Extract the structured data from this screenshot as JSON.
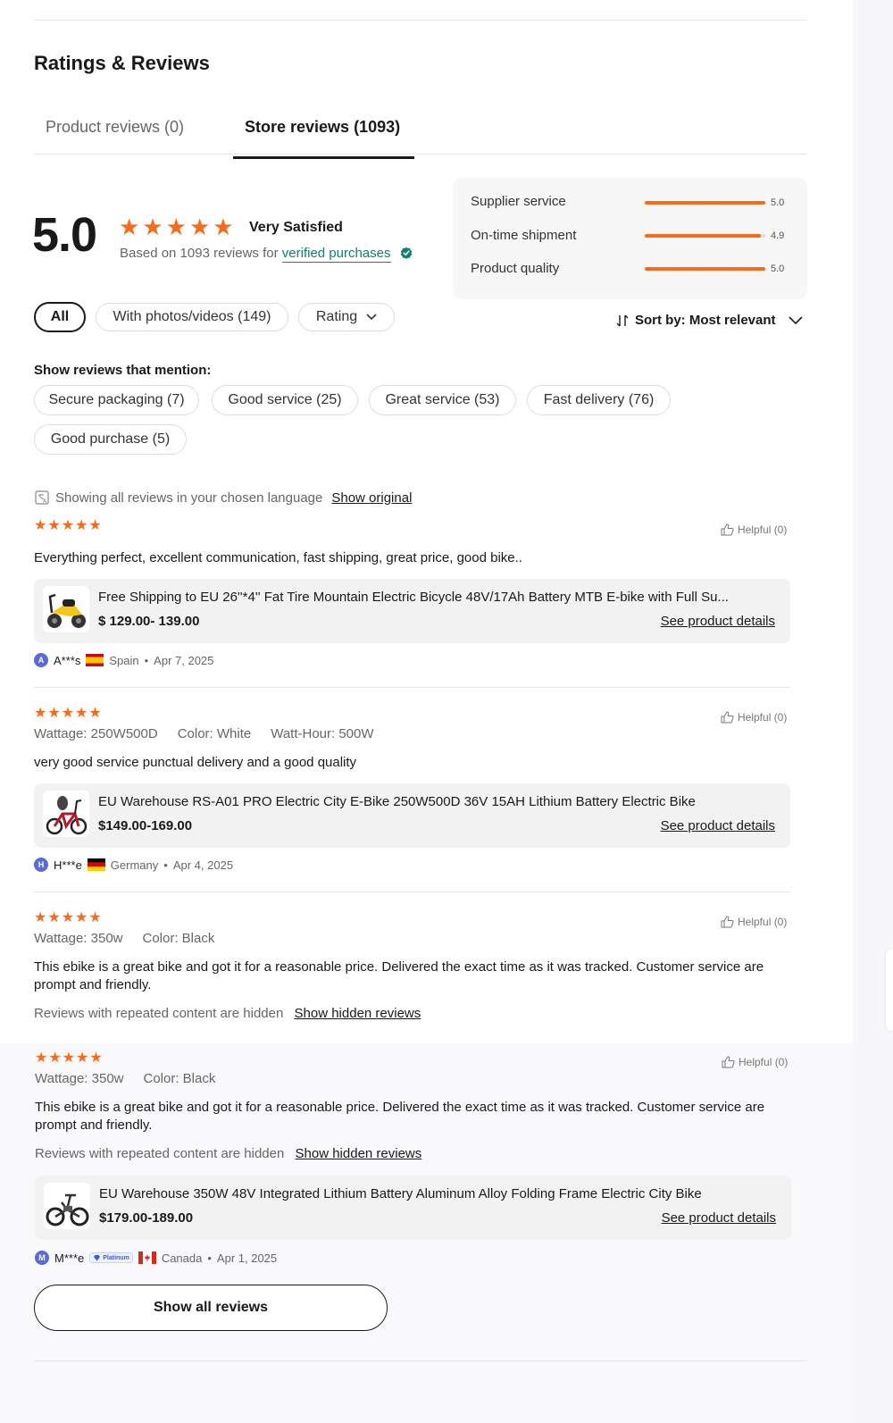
{
  "section_title": "Ratings & Reviews",
  "tabs": [
    {
      "label": "Product reviews (0)",
      "active": false
    },
    {
      "label": "Store reviews (1093)",
      "active": true
    }
  ],
  "summary": {
    "score": "5.0",
    "star_count": 5,
    "satisfaction": "Very Satisfied",
    "based_prefix": "Based on 1093 reviews for",
    "verified_link": "verified purchases"
  },
  "metrics": [
    {
      "label": "Supplier service",
      "value": "5.0",
      "fraction": 1.0
    },
    {
      "label": "On-time shipment",
      "value": "4.9",
      "fraction": 0.96
    },
    {
      "label": "Product quality",
      "value": "5.0",
      "fraction": 1.0
    }
  ],
  "filters": {
    "all": "All",
    "photos": "With photos/videos (149)",
    "rating": "Rating"
  },
  "sort": {
    "label": "Sort by: Most relevant"
  },
  "mentions": {
    "label": "Show reviews that mention:",
    "tags": [
      "Secure packaging (7)",
      "Good service (25)",
      "Great service (53)",
      "Fast delivery (76)",
      "Good purchase (5)"
    ]
  },
  "language": {
    "text": "Showing all reviews in your chosen language",
    "link": "Show original"
  },
  "reviews": [
    {
      "rating": 5,
      "helpful": "Helpful (0)",
      "text": "Everything perfect, excellent communication, fast shipping, great price, good bike..",
      "product": {
        "title": "Free Shipping to EU 26''*4'' Fat Tire Mountain Electric Bicycle 48V/17Ah Battery MTB E-bike with Full Su...",
        "price": "$  129.00- 139.00",
        "link": "See product details"
      },
      "user": {
        "initial": "A",
        "name": "A***s",
        "country": "Spain",
        "date": "Apr 7, 2025"
      }
    },
    {
      "rating": 5,
      "helpful": "Helpful (0)",
      "attrs": [
        "Wattage:  250W500D",
        "Color:  White",
        "Watt-Hour:  500W"
      ],
      "text": "very good service punctual delivery and a good quality",
      "product": {
        "title": "EU Warehouse RS-A01 PRO Electric City E-Bike 250W500D 36V 15AH Lithium Battery Electric Bike",
        "price": "$149.00-169.00",
        "link": "See product details"
      },
      "user": {
        "initial": "H",
        "name": "H***e",
        "country": "Germany",
        "date": "Apr 4, 2025"
      }
    },
    {
      "rating": 5,
      "helpful": "Helpful (0)",
      "attrs": [
        "Wattage:  350w",
        "Color:  Black"
      ],
      "text": "This ebike is a great bike and got it for a reasonable price. Delivered the exact time as it was tracked. Customer service are prompt and friendly.",
      "hidden_note": "Reviews with repeated content are hidden",
      "hidden_link": "Show hidden reviews"
    },
    {
      "rating": 5,
      "helpful": "Helpful (0)",
      "attrs": [
        "Wattage:  350w",
        "Color:  Black"
      ],
      "text": "This ebike is a great bike and got it for a reasonable price. Delivered the exact time as it was tracked. Customer service are prompt and friendly.",
      "hidden_note": "Reviews with repeated content are hidden",
      "hidden_link": "Show hidden reviews",
      "product": {
        "title": "EU Warehouse 350W 48V Integrated Lithium Battery Aluminum Alloy Folding Frame Electric City Bike",
        "price": "$179.00-189.00",
        "link": "See product details"
      },
      "user": {
        "initial": "M",
        "name": "M***e",
        "badge": "Platinum",
        "country": "Canada",
        "date": "Apr 1, 2025"
      }
    }
  ],
  "show_all": "Show all reviews",
  "colors": {
    "accent": "#f76b1c",
    "verified": "#12806b",
    "text": "#191919",
    "muted": "#666666"
  }
}
